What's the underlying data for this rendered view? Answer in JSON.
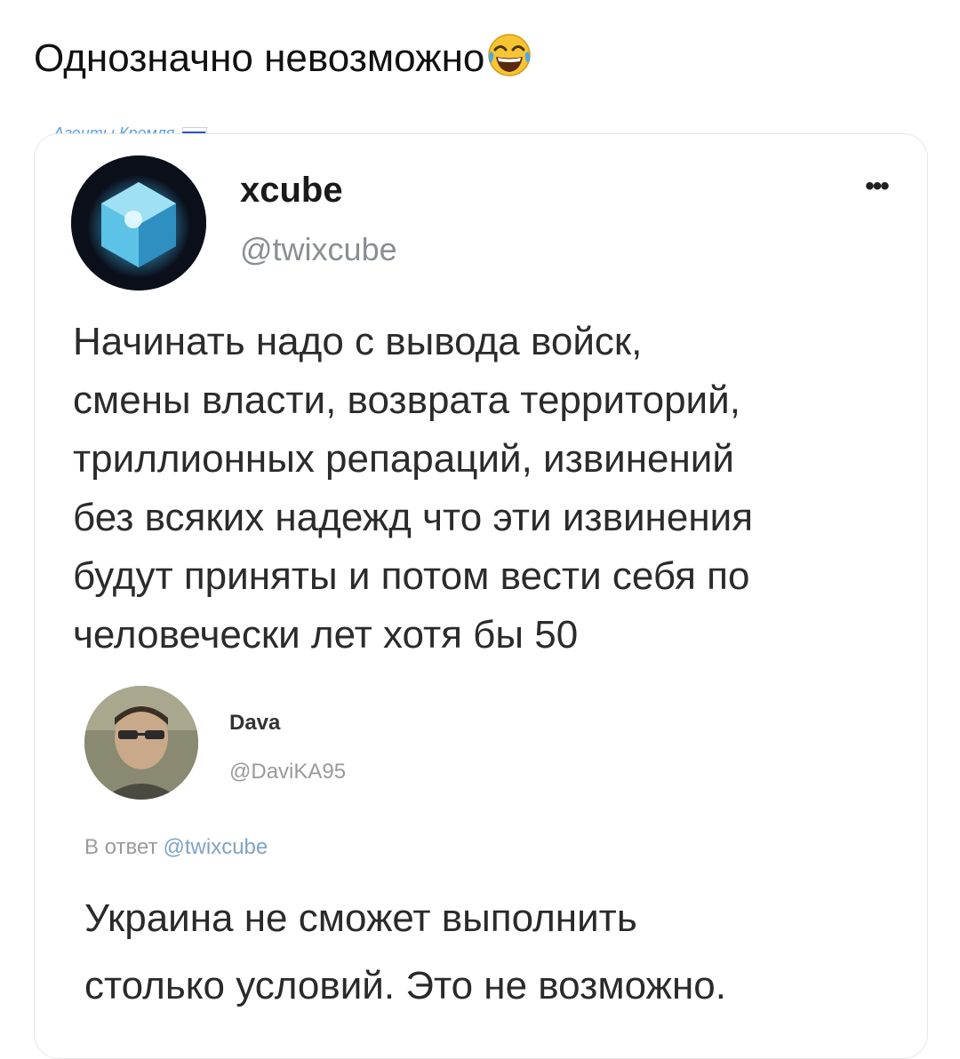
{
  "caption": {
    "text": "Однозначно невозможно",
    "emoji_icon": "tears-of-joy-emoji"
  },
  "watermark": {
    "text": "Агенты Кремля",
    "flag_icon": "russian-flag-icon"
  },
  "tweet": {
    "author_name": "xcube",
    "author_handle": "@twixcube",
    "more_icon": "more-options-icon",
    "more_glyph": "•••",
    "text_lines": [
      "Начинать надо с вывода войск,",
      "смены власти, возврата территорий,",
      "триллионных репараций, извинений",
      "без всяких надежд что эти извинения",
      "будут приняты и потом вести себя по",
      "человечески лет хотя бы 50"
    ]
  },
  "reply": {
    "author_name": "Dava",
    "author_handle": "@DaviKA95",
    "reply_prefix": "В ответ",
    "reply_to": "@twixcube",
    "text_lines": [
      "Украина не сможет выполнить",
      "столько условий. Это не возможно."
    ]
  },
  "colors": {
    "background": "#ffffff",
    "text": "#111111",
    "secondary_text": "#8a8f94",
    "watermark": "#5f9ee0",
    "mention": "#7fa3c5"
  }
}
